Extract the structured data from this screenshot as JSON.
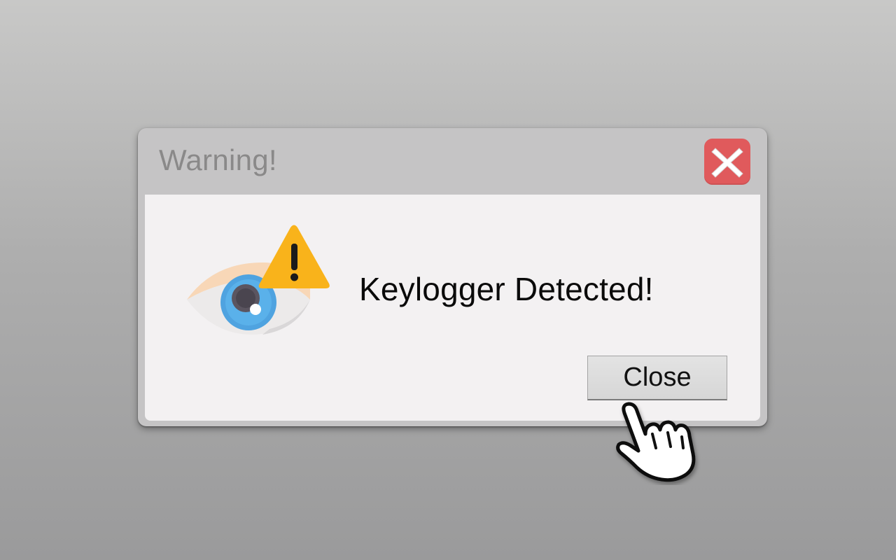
{
  "dialog": {
    "title": "Warning!",
    "message": "Keylogger Detected!",
    "close_button_label": "Close",
    "titlebar_close_glyph": "X"
  },
  "icons": {
    "titlebar_close": "close-x-icon",
    "main": "eye-warning-icon",
    "cursor": "hand-pointer-cursor-icon"
  },
  "colors": {
    "titlebar_close_bg": "#e05a5c",
    "warning_triangle": "#f9b31b",
    "iris": "#4fa3e0",
    "eyelid": "#f7d6b6"
  }
}
